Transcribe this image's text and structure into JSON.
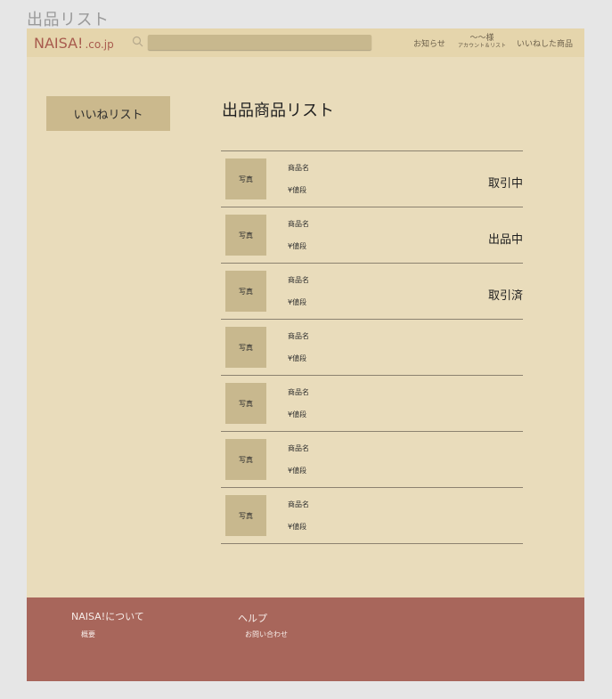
{
  "page_label": "出品リスト",
  "header": {
    "logo": "NAISA!",
    "logo_domain": ".co.jp",
    "search": {
      "value": "",
      "placeholder": ""
    },
    "nav_news": "お知らせ",
    "nav_account_name": "〜〜様",
    "nav_account_sub": "アカウント＆リスト",
    "nav_liked": "いいねした商品"
  },
  "sidebar": {
    "like_list_label": "いいねリスト"
  },
  "main": {
    "title": "出品商品リスト",
    "products": [
      {
        "photo": "写真",
        "name": "商品名",
        "price": "¥値段",
        "status": "取引中"
      },
      {
        "photo": "写真",
        "name": "商品名",
        "price": "¥値段",
        "status": "出品中"
      },
      {
        "photo": "写真",
        "name": "商品名",
        "price": "¥値段",
        "status": "取引済"
      },
      {
        "photo": "写真",
        "name": "商品名",
        "price": "¥値段",
        "status": ""
      },
      {
        "photo": "写真",
        "name": "商品名",
        "price": "¥値段",
        "status": ""
      },
      {
        "photo": "写真",
        "name": "商品名",
        "price": "¥値段",
        "status": ""
      },
      {
        "photo": "写真",
        "name": "商品名",
        "price": "¥値段",
        "status": ""
      }
    ]
  },
  "footer": {
    "about_heading": "NAISA!について",
    "about_link": "概要",
    "help_heading": "ヘルプ",
    "help_link": "お問い合わせ"
  },
  "colors": {
    "page_background": "#e9dcbb",
    "header_background": "#e5d5ac",
    "accent_tan": "#c8b88e",
    "logo_red": "#a85b4e",
    "footer_background": "#a8665b"
  },
  "icons": {
    "search": "search-icon"
  }
}
